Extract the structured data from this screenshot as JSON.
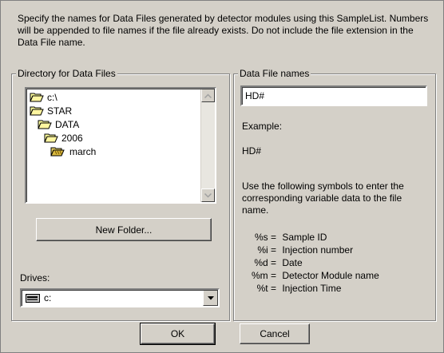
{
  "intro": "Specify the names for Data Files generated by detector modules using this SampleList. Numbers will be appended to file names if the file already exists. Do not include the file extension in the Data File name.",
  "directory_group": {
    "title": "Directory for Data Files",
    "tree": [
      {
        "label": "c:\\",
        "icon": "open-folder-icon"
      },
      {
        "label": "STAR",
        "icon": "open-folder-icon"
      },
      {
        "label": "DATA",
        "icon": "open-folder-icon"
      },
      {
        "label": "2006",
        "icon": "open-folder-icon"
      },
      {
        "label": "march",
        "icon": "selected-open-folder-icon"
      }
    ],
    "new_folder_label": "New Folder...",
    "drives_label": "Drives:",
    "drive_value": "c:"
  },
  "datafile_group": {
    "title": "Data File names",
    "input_value": "HD#",
    "example_label": "Example:",
    "example_value": "HD#",
    "help_text": "Use the following symbols to enter the corresponding variable data to the file name.",
    "symbols": [
      {
        "key": "%s =",
        "desc": "Sample ID"
      },
      {
        "key": "%i =",
        "desc": "Injection number"
      },
      {
        "key": "%d =",
        "desc": "Date"
      },
      {
        "key": "%m =",
        "desc": "Detector Module name"
      },
      {
        "key": "%t =",
        "desc": "Injection Time"
      }
    ]
  },
  "buttons": {
    "ok": "OK",
    "cancel": "Cancel"
  }
}
